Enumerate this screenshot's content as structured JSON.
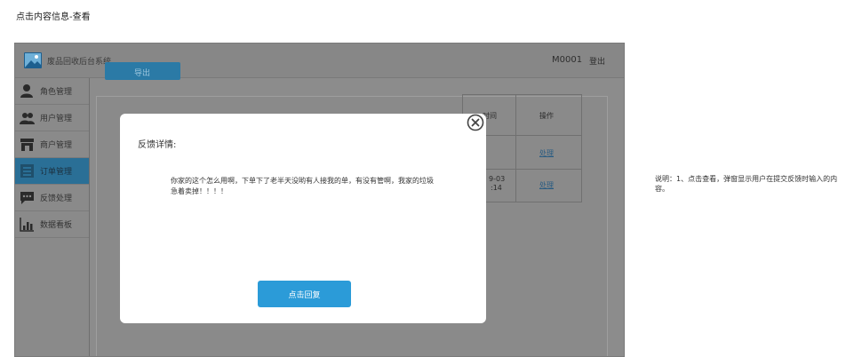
{
  "caption": "点击内容信息-查看",
  "note": "说明：1、点击查看，弹窗显示用户在提交反馈时输入的内容。",
  "header": {
    "app_title": "废品回收后台系统",
    "user_id": "M0001",
    "logout_label": "登出"
  },
  "sidebar": {
    "items": [
      {
        "label": "角色管理",
        "icon": "user-role-icon"
      },
      {
        "label": "用户管理",
        "icon": "users-icon"
      },
      {
        "label": "商户管理",
        "icon": "store-icon"
      },
      {
        "label": "订单管理",
        "icon": "order-list-icon",
        "active": true
      },
      {
        "label": "反馈处理",
        "icon": "chat-icon"
      },
      {
        "label": "数据看板",
        "icon": "bar-chart-icon"
      }
    ]
  },
  "main": {
    "export_label": "导出",
    "table": {
      "headers": [
        "时间",
        "操作"
      ],
      "rows": [
        {
          "time": "",
          "action": "处理"
        },
        {
          "time_line1": "9-03",
          "time_line2": ":14",
          "action": "处理"
        }
      ]
    }
  },
  "modal": {
    "title": "反馈详情:",
    "content": "你家的这个怎么用啊，下单下了老半天没哟有人接我的单，有没有管啊，我家的垃圾急着卖掉！！！！",
    "reply_label": "点击回复",
    "close_icon": "close-circle-icon"
  },
  "colors": {
    "primary": "#2b9bd8",
    "overlay": "#8a8a8a",
    "active_nav": "#2a6f96"
  }
}
